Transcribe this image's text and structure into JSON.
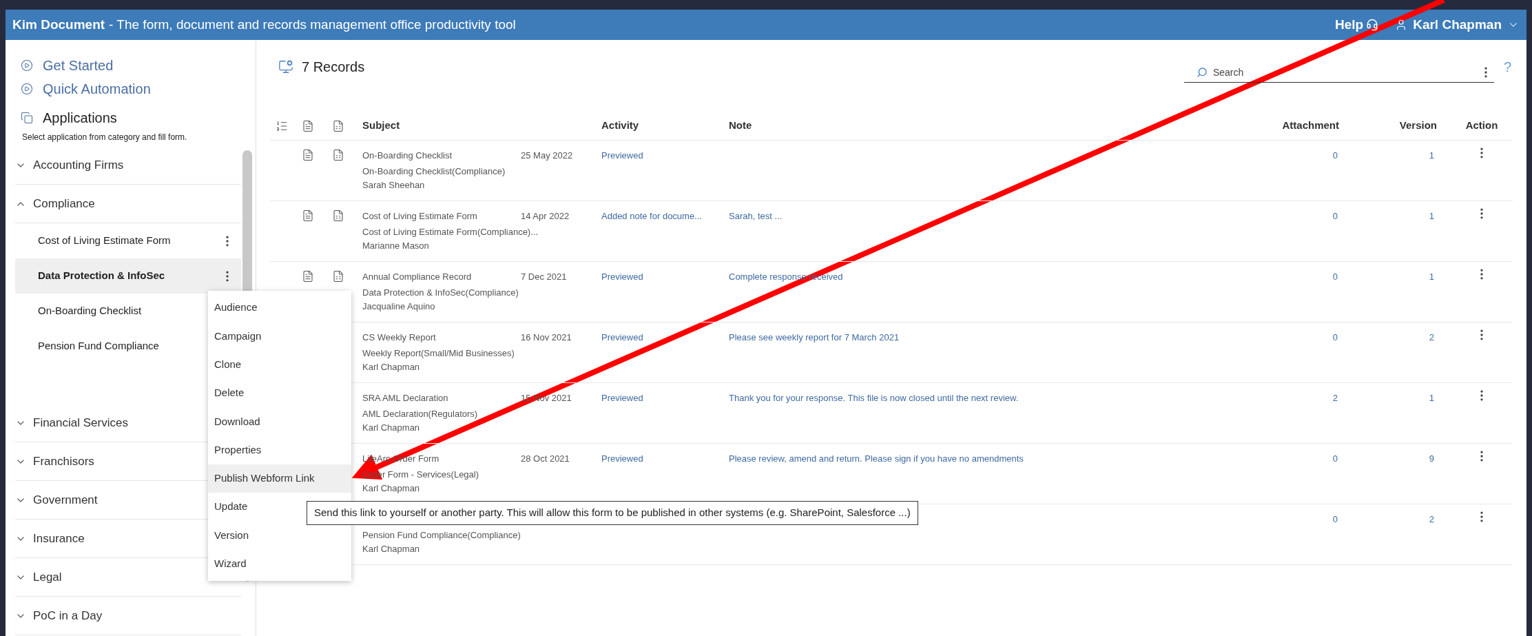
{
  "header": {
    "app_name": "Kim Document",
    "tagline": "- The form, document and records management office productivity tool",
    "help": "Help",
    "user": "Karl Chapman"
  },
  "sidebar": {
    "links": [
      "Get Started",
      "Quick Automation"
    ],
    "section_title": "Applications",
    "section_hint": "Select application from category and fill form.",
    "categories": [
      {
        "label": "Accounting Firms",
        "expanded": false
      },
      {
        "label": "Compliance",
        "expanded": true,
        "children": [
          {
            "label": "Cost of Living Estimate Form",
            "selected": false
          },
          {
            "label": "Data Protection & InfoSec",
            "selected": true
          },
          {
            "label": "On-Boarding Checklist",
            "selected": false
          },
          {
            "label": "Pension Fund Compliance",
            "selected": false
          }
        ]
      },
      {
        "label": "Financial Services",
        "expanded": false
      },
      {
        "label": "Franchisors",
        "expanded": false
      },
      {
        "label": "Government",
        "expanded": false
      },
      {
        "label": "Insurance",
        "expanded": false
      },
      {
        "label": "Legal",
        "expanded": false
      },
      {
        "label": "PoC in a Day",
        "expanded": false
      }
    ]
  },
  "main": {
    "title": "7 Records",
    "search": {
      "placeholder": "Search"
    },
    "help_mark": "?",
    "columns": [
      "Subject",
      "Activity",
      "Note",
      "Attachment",
      "Version",
      "Action"
    ],
    "rows": [
      {
        "subject": "On-Boarding Checklist",
        "date": "25 May 2022",
        "form": "On-Boarding Checklist(Compliance)",
        "owner": "Sarah Sheehan",
        "file_icons": true,
        "activity": "Previewed",
        "attachment": "0",
        "version": "1"
      },
      {
        "subject": "Cost of Living Estimate Form",
        "date": "14 Apr 2022",
        "form": "Cost of Living Estimate Form(Compliance)...",
        "owner": "Marianne Mason",
        "file_icons": true,
        "activity": "Added note for docume...",
        "note": "Sarah, test ...",
        "attachment": "0",
        "version": "1"
      },
      {
        "subject": "Annual Compliance Record",
        "date": "7 Dec 2021",
        "form": "Data Protection & InfoSec(Compliance)",
        "owner": "Jacqualine Aquino",
        "file_icons": true,
        "activity": "Previewed",
        "note": "Complete response received",
        "attachment": "0",
        "version": "1"
      },
      {
        "subject": "CS Weekly Report",
        "date": "16 Nov 2021",
        "form": "Weekly Report(Small/Mid Businesses)",
        "owner": "Karl Chapman",
        "activity": "Previewed",
        "note": "Please see weekly report for 7 March 2021",
        "attachment": "0",
        "version": "2"
      },
      {
        "subject": "SRA AML Declaration",
        "date": "15 Nov 2021",
        "form": "AML Declaration(Regulators)",
        "owner": "Karl Chapman",
        "activity": "Previewed",
        "note": "Thank you for your response. This file is now closed until the next review.",
        "attachment": "2",
        "version": "1"
      },
      {
        "subject": "LifeArc Order Form",
        "date": "28 Oct 2021",
        "form": "Order Form - Services(Legal)",
        "owner": "Karl Chapman",
        "activity": "Previewed",
        "note": "Please review, amend and return. Please sign if you have no amendments",
        "attachment": "0",
        "version": "9"
      },
      {
        "form": "Pension Fund Compliance(Compliance)",
        "owner": "Karl Chapman",
        "attachment": "0",
        "version": "2"
      }
    ]
  },
  "context_menu": {
    "items": [
      {
        "label": "Audience",
        "selected": false
      },
      {
        "label": "Campaign",
        "selected": false
      },
      {
        "label": "Clone",
        "selected": false
      },
      {
        "label": "Delete",
        "selected": false
      },
      {
        "label": "Download",
        "selected": false
      },
      {
        "label": "Properties",
        "selected": false
      },
      {
        "label": "Publish Webform Link",
        "selected": true
      },
      {
        "label": "Update",
        "selected": false
      },
      {
        "label": "Version",
        "selected": false
      },
      {
        "label": "Wizard",
        "selected": false
      }
    ]
  },
  "tooltip": "Send this link to yourself or another party. This will allow this form to be published in other systems (e.g. SharePoint, Salesforce ...)"
}
